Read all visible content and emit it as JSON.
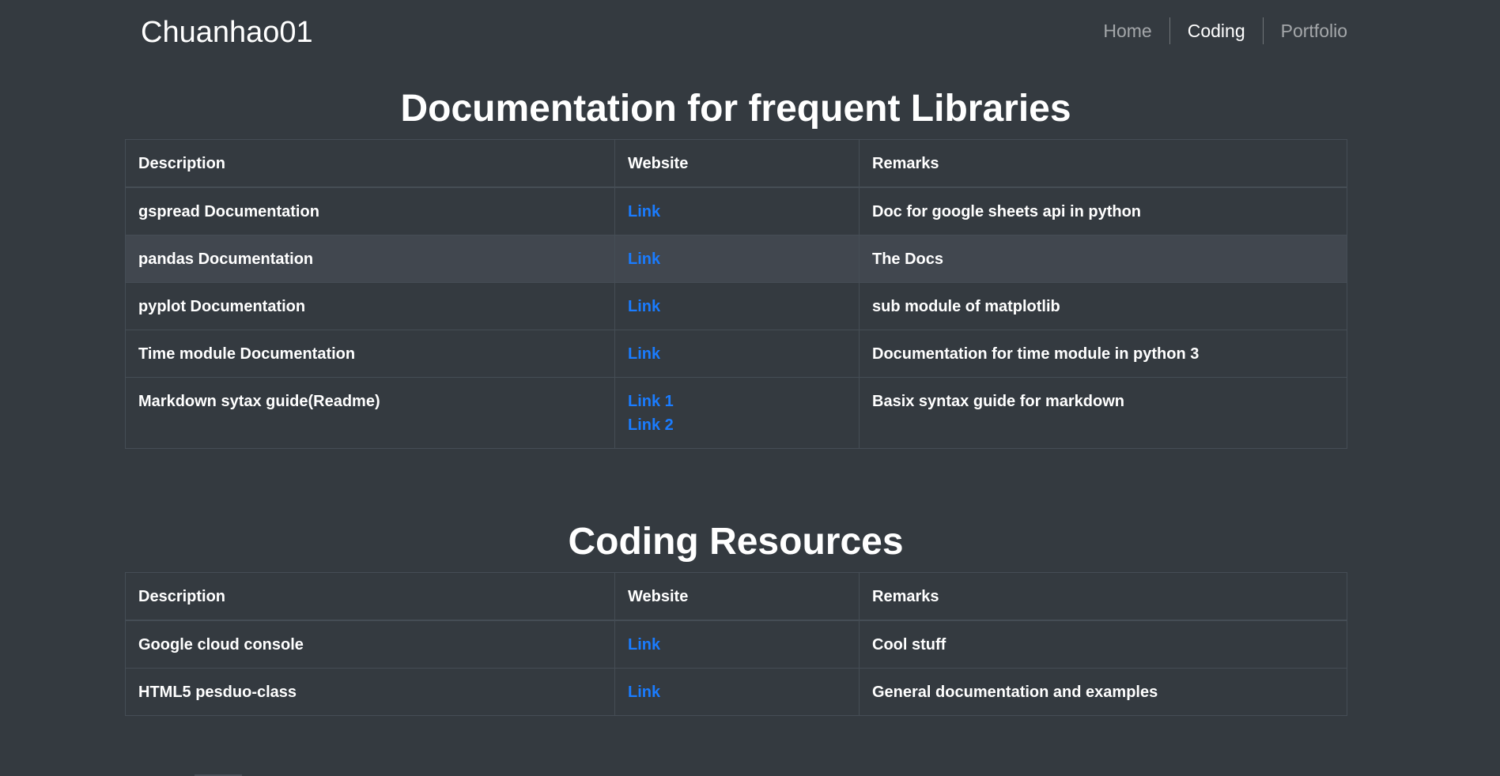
{
  "navbar": {
    "brand": "Chuanhao01",
    "links": [
      {
        "label": "Home",
        "active": false
      },
      {
        "label": "Coding",
        "active": true
      },
      {
        "label": "Portfolio",
        "active": false
      }
    ]
  },
  "colors": {
    "background": "#343a40",
    "link": "#1a7cff",
    "text": "#ffffff",
    "border": "#454d55",
    "hover_row": "#41474f"
  },
  "sections": [
    {
      "title": "Documentation for frequent Libraries",
      "headers": {
        "description": "Description",
        "website": "Website",
        "remarks": "Remarks"
      },
      "rows": [
        {
          "description": "gspread Documentation",
          "links": [
            "Link"
          ],
          "remarks": "Doc for google sheets api in python"
        },
        {
          "description": "pandas Documentation",
          "links": [
            "Link"
          ],
          "remarks": "The Docs"
        },
        {
          "description": "pyplot Documentation",
          "links": [
            "Link"
          ],
          "remarks": "sub module of matplotlib"
        },
        {
          "description": "Time module Documentation",
          "links": [
            "Link"
          ],
          "remarks": "Documentation for time module in python 3"
        },
        {
          "description": "Markdown sytax guide(Readme)",
          "links": [
            "Link 1",
            "Link 2"
          ],
          "remarks": "Basix syntax guide for markdown"
        }
      ]
    },
    {
      "title": "Coding Resources",
      "headers": {
        "description": "Description",
        "website": "Website",
        "remarks": "Remarks"
      },
      "rows": [
        {
          "description": "Google cloud console",
          "links": [
            "Link"
          ],
          "remarks": "Cool stuff"
        },
        {
          "description": "HTML5 pesduo-class",
          "links": [
            "Link"
          ],
          "remarks": "General documentation and examples"
        }
      ]
    }
  ]
}
